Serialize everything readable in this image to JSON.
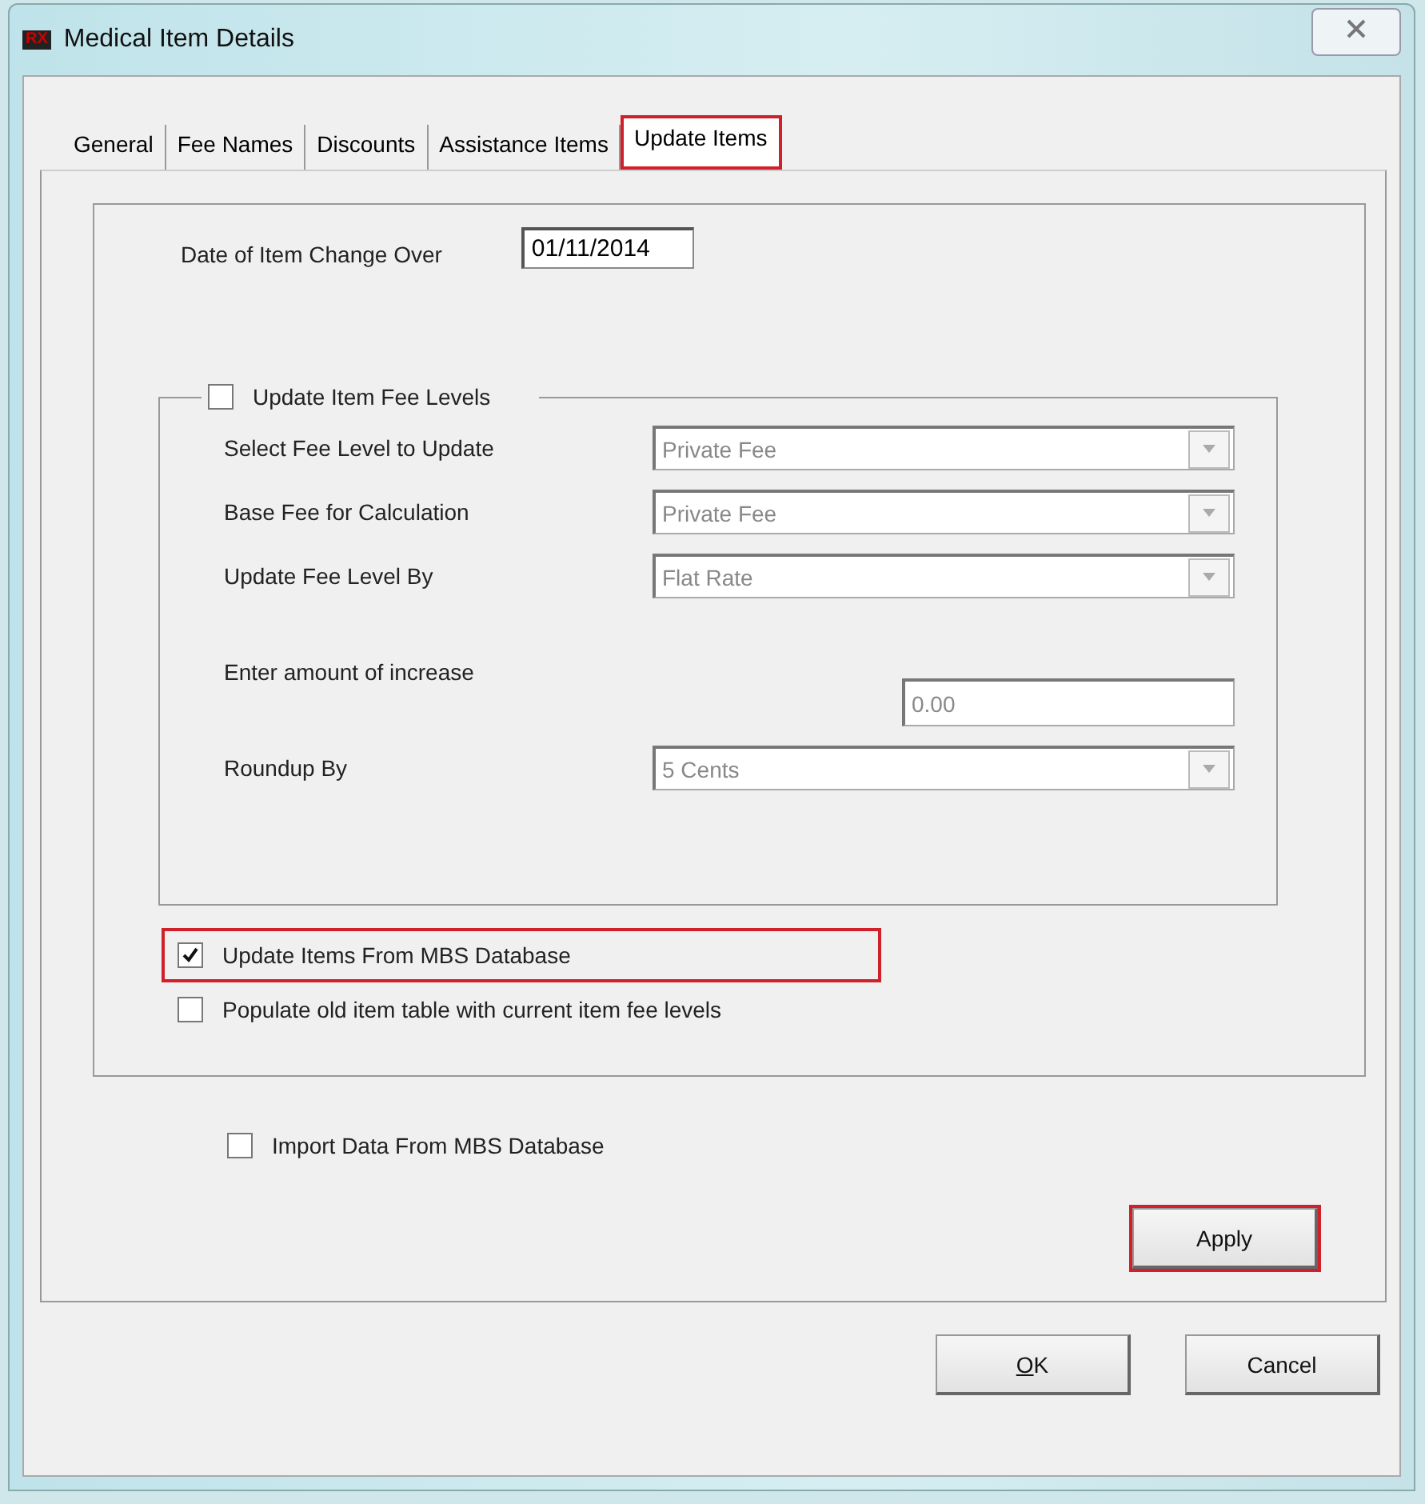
{
  "window": {
    "title": "Medical Item Details",
    "logo_text": "RX"
  },
  "tabs": [
    {
      "label": "General",
      "selected": false,
      "highlighted": false
    },
    {
      "label": "Fee Names",
      "selected": false,
      "highlighted": false
    },
    {
      "label": "Discounts",
      "selected": false,
      "highlighted": false
    },
    {
      "label": "Assistance Items",
      "selected": false,
      "highlighted": false
    },
    {
      "label": "Update Items",
      "selected": true,
      "highlighted": true
    }
  ],
  "change_over": {
    "label": "Date of Item Change Over",
    "value": "01/11/2014"
  },
  "fee_group": {
    "label": "Update Item Fee Levels",
    "checked": false,
    "rows": [
      {
        "kind": "dropdown",
        "label": "Select Fee Level to Update",
        "value": "Private Fee",
        "disabled": true
      },
      {
        "kind": "dropdown",
        "label": "Base Fee for Calculation",
        "value": "Private Fee",
        "disabled": true
      },
      {
        "kind": "dropdown",
        "label": "Update Fee Level By",
        "value": "Flat Rate",
        "disabled": true
      },
      {
        "kind": "amount",
        "label": "Enter amount of increase",
        "value": "0.00",
        "disabled": true
      },
      {
        "kind": "dropdown",
        "label": "Roundup By",
        "value": "5 Cents",
        "disabled": true
      }
    ]
  },
  "options": [
    {
      "label": "Update Items From MBS Database",
      "checked": true,
      "highlighted": true
    },
    {
      "label": "Populate old item table with current item fee levels",
      "checked": false,
      "highlighted": false
    }
  ],
  "import": {
    "label": "Import Data From MBS Database",
    "checked": false
  },
  "apply": {
    "label": "Apply",
    "highlighted": true
  },
  "buttons": [
    {
      "label": "OK",
      "underline_first": true
    },
    {
      "label": "Cancel",
      "underline_first": false
    }
  ]
}
